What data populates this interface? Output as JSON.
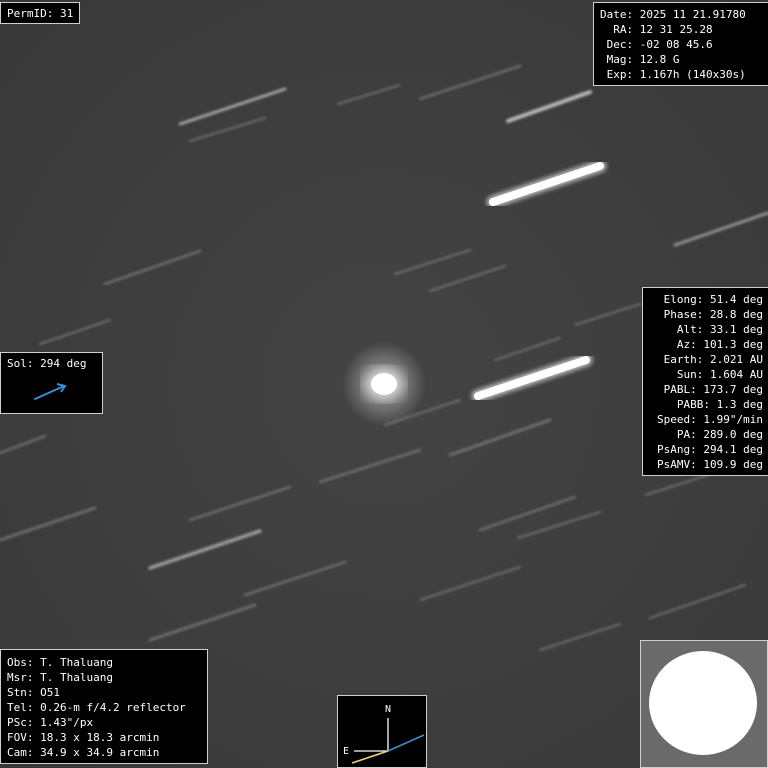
{
  "permid": "PermID: 31",
  "info": {
    "date": "Date: 2025 11 21.91780",
    "ra": "  RA: 12 31 25.28",
    "dec": " Dec: -02 08 45.6",
    "mag": " Mag: 12.8 G",
    "exp": " Exp: 1.167h (140x30s)"
  },
  "geometry": [
    "Elong: 51.4 deg",
    "Phase: 28.8 deg",
    "Alt: 33.1 deg",
    "Az: 101.3 deg",
    "Earth: 2.021 AU",
    "Sun: 1.604 AU",
    "PABL: 173.7 deg",
    "PABB: 1.3 deg",
    "Speed: 1.99\"/min",
    "PA: 289.0 deg",
    "PsAng: 294.1 deg",
    "PsAMV: 109.9 deg"
  ],
  "sol": {
    "label": "Sol: 294 deg",
    "arrow_color": "#3a8fd0"
  },
  "observer": [
    "Obs: T. Thaluang",
    "Msr: T. Thaluang",
    "Stn: O51",
    "Tel: 0.26-m f/4.2 reflector",
    "PSc: 1.43\"/px",
    "FOV: 18.3 x 18.3 arcmin",
    "Cam: 34.9 x 34.9 arcmin"
  ],
  "compass": {
    "north": "N",
    "east": "E",
    "motion_color": "#3a8fd0",
    "east_line_color": "#e8d27a"
  },
  "colors": {
    "background": "#3c3c3c",
    "panel": "#000000",
    "text": "#ffffff"
  }
}
